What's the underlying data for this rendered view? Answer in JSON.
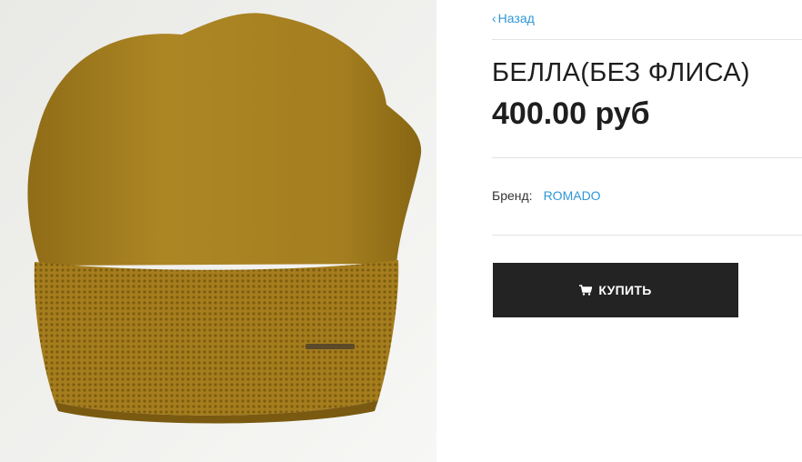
{
  "nav": {
    "back_label": "Назад"
  },
  "product": {
    "title": "БЕЛЛА(БЕЗ ФЛИСА)",
    "price": "400.00 руб",
    "brand_label": "Бренд:",
    "brand_value": "ROMADO",
    "buy_label": "КУПИТЬ"
  },
  "image": {
    "subject": "mustard knit beanie hat",
    "colors": {
      "hat": "#a9821f",
      "cuff": "#a07a1c",
      "background": "#f2f2f0"
    }
  },
  "colors": {
    "link": "#2f97d6",
    "text": "#1e1e1e",
    "button_bg": "#232323",
    "button_text": "#ffffff"
  }
}
